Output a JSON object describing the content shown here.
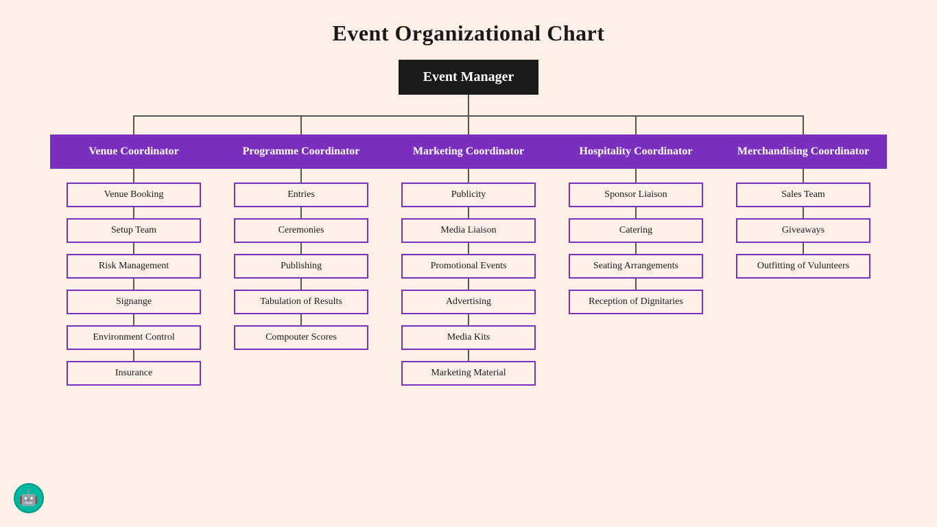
{
  "title": "Event Organizational Chart",
  "root": "Event Manager",
  "columns": [
    {
      "header": "Venue Coordinator",
      "children": [
        "Venue Booking",
        "Setup Team",
        "Risk Management",
        "Signange",
        "Environment Control",
        "Insurance"
      ]
    },
    {
      "header": "Programme Coordinator",
      "children": [
        "Entries",
        "Ceremonies",
        "Publishing",
        "Tabulation of Results",
        "Compouter Scores"
      ]
    },
    {
      "header": "Marketing Coordinator",
      "children": [
        "Publicity",
        "Media Liaison",
        "Promotional Events",
        "Advertising",
        "Media Kits",
        "Marketing Material"
      ]
    },
    {
      "header": "Hospitality Coordinator",
      "children": [
        "Sponsor Liaison",
        "Catering",
        "Seating Arrangements",
        "Reception of Dignitaries"
      ]
    },
    {
      "header": "Merchandising Coordinator",
      "children": [
        "Sales Team",
        "Giveaways",
        "Outfitting of Vulunteers"
      ]
    }
  ],
  "robot_icon": "🤖"
}
